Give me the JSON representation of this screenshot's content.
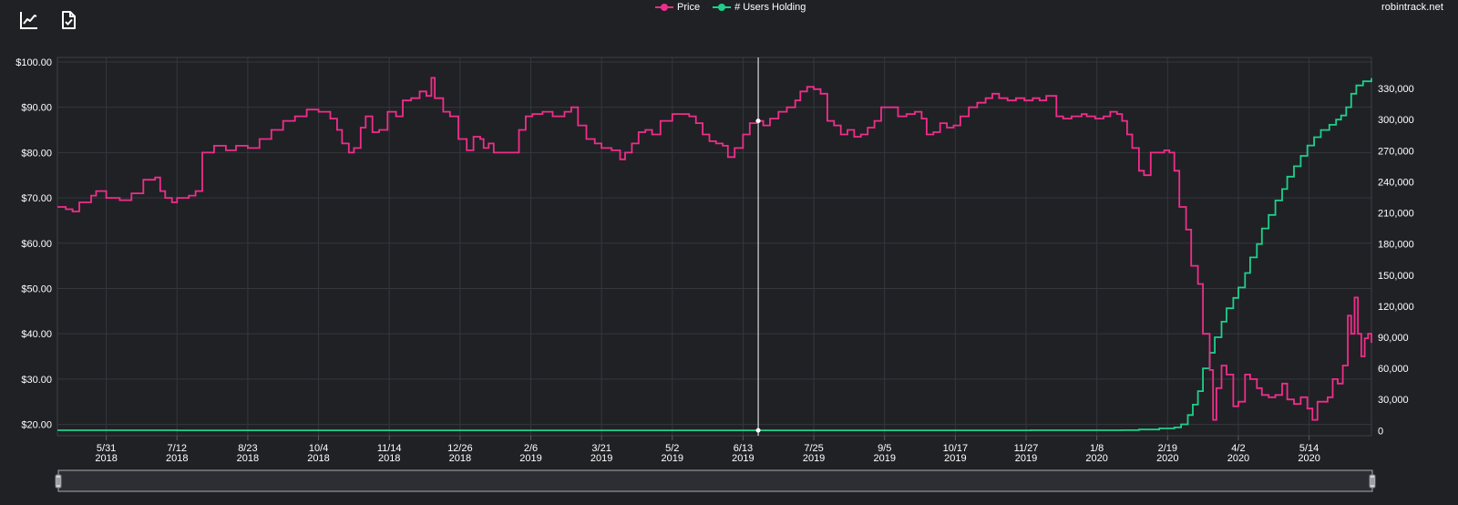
{
  "site": "robintrack.net",
  "toolbar": {
    "icons": [
      "line-chart-icon",
      "file-check-icon"
    ]
  },
  "colors": {
    "price": "#f02d8a",
    "users": "#1ed08a",
    "grid": "#34373c",
    "background": "#1f2125"
  },
  "chart_data": {
    "type": "line",
    "title": "",
    "legend_position": "top-center",
    "grid": true,
    "series": [
      {
        "name": "Price",
        "axis": "left",
        "points": [
          [
            "2018-05-02",
            68.0
          ],
          [
            "2018-05-07",
            67.5
          ],
          [
            "2018-05-11",
            67.0
          ],
          [
            "2018-05-15",
            69.0
          ],
          [
            "2018-05-22",
            70.5
          ],
          [
            "2018-05-25",
            71.5
          ],
          [
            "2018-05-31",
            70.0
          ],
          [
            "2018-06-08",
            69.5
          ],
          [
            "2018-06-15",
            71.0
          ],
          [
            "2018-06-22",
            74.0
          ],
          [
            "2018-06-29",
            74.5
          ],
          [
            "2018-07-02",
            71.5
          ],
          [
            "2018-07-05",
            70.0
          ],
          [
            "2018-07-09",
            69.0
          ],
          [
            "2018-07-12",
            70.0
          ],
          [
            "2018-07-19",
            70.5
          ],
          [
            "2018-07-23",
            71.5
          ],
          [
            "2018-07-26",
            71.5
          ],
          [
            "2018-07-27",
            80.0
          ],
          [
            "2018-08-03",
            81.5
          ],
          [
            "2018-08-10",
            80.5
          ],
          [
            "2018-08-16",
            81.5
          ],
          [
            "2018-08-23",
            81.0
          ],
          [
            "2018-08-30",
            83.0
          ],
          [
            "2018-09-06",
            85.0
          ],
          [
            "2018-09-13",
            87.0
          ],
          [
            "2018-09-20",
            88.0
          ],
          [
            "2018-09-27",
            89.5
          ],
          [
            "2018-10-04",
            89.0
          ],
          [
            "2018-10-11",
            87.5
          ],
          [
            "2018-10-15",
            85.0
          ],
          [
            "2018-10-18",
            82.0
          ],
          [
            "2018-10-22",
            80.0
          ],
          [
            "2018-10-25",
            81.0
          ],
          [
            "2018-10-29",
            85.5
          ],
          [
            "2018-11-01",
            88.0
          ],
          [
            "2018-11-05",
            84.5
          ],
          [
            "2018-11-09",
            85.0
          ],
          [
            "2018-11-14",
            89.0
          ],
          [
            "2018-11-19",
            88.0
          ],
          [
            "2018-11-23",
            91.5
          ],
          [
            "2018-11-28",
            92.0
          ],
          [
            "2018-12-03",
            93.5
          ],
          [
            "2018-12-07",
            92.5
          ],
          [
            "2018-12-10",
            96.5
          ],
          [
            "2018-12-12",
            92.0
          ],
          [
            "2018-12-17",
            89.0
          ],
          [
            "2018-12-21",
            88.0
          ],
          [
            "2018-12-26",
            83.0
          ],
          [
            "2018-12-31",
            80.5
          ],
          [
            "2019-01-04",
            83.5
          ],
          [
            "2019-01-08",
            83.0
          ],
          [
            "2019-01-10",
            81.0
          ],
          [
            "2019-01-13",
            82.0
          ],
          [
            "2019-01-16",
            80.0
          ],
          [
            "2019-01-31",
            85.0
          ],
          [
            "2019-02-04",
            88.0
          ],
          [
            "2019-02-08",
            88.5
          ],
          [
            "2019-02-14",
            89.0
          ],
          [
            "2019-02-20",
            88.0
          ],
          [
            "2019-02-27",
            89.0
          ],
          [
            "2019-03-03",
            90.0
          ],
          [
            "2019-03-07",
            86.0
          ],
          [
            "2019-03-12",
            83.0
          ],
          [
            "2019-03-17",
            82.0
          ],
          [
            "2019-03-21",
            81.0
          ],
          [
            "2019-03-27",
            80.5
          ],
          [
            "2019-04-01",
            78.5
          ],
          [
            "2019-04-04",
            80.0
          ],
          [
            "2019-04-08",
            82.0
          ],
          [
            "2019-04-12",
            84.5
          ],
          [
            "2019-04-16",
            85.0
          ],
          [
            "2019-04-20",
            84.0
          ],
          [
            "2019-04-25",
            87.0
          ],
          [
            "2019-05-02",
            88.5
          ],
          [
            "2019-05-07",
            88.5
          ],
          [
            "2019-05-12",
            88.0
          ],
          [
            "2019-05-16",
            86.5
          ],
          [
            "2019-05-20",
            84.0
          ],
          [
            "2019-05-24",
            82.5
          ],
          [
            "2019-05-28",
            82.0
          ],
          [
            "2019-06-01",
            81.5
          ],
          [
            "2019-06-04",
            79.0
          ],
          [
            "2019-06-08",
            81.0
          ],
          [
            "2019-06-13",
            84.0
          ],
          [
            "2019-06-17",
            86.5
          ],
          [
            "2019-06-21",
            87.0
          ],
          [
            "2019-06-25",
            86.0
          ],
          [
            "2019-06-29",
            87.5
          ],
          [
            "2019-07-04",
            89.0
          ],
          [
            "2019-07-09",
            90.0
          ],
          [
            "2019-07-14",
            91.5
          ],
          [
            "2019-07-17",
            93.5
          ],
          [
            "2019-07-21",
            94.5
          ],
          [
            "2019-07-25",
            94.0
          ],
          [
            "2019-07-29",
            93.0
          ],
          [
            "2019-08-02",
            87.0
          ],
          [
            "2019-08-06",
            86.0
          ],
          [
            "2019-08-10",
            84.0
          ],
          [
            "2019-08-14",
            85.0
          ],
          [
            "2019-08-18",
            83.5
          ],
          [
            "2019-08-22",
            84.0
          ],
          [
            "2019-08-26",
            85.5
          ],
          [
            "2019-08-30",
            87.0
          ],
          [
            "2019-09-03",
            90.0
          ],
          [
            "2019-09-08",
            90.0
          ],
          [
            "2019-09-13",
            88.0
          ],
          [
            "2019-09-18",
            88.5
          ],
          [
            "2019-09-23",
            89.0
          ],
          [
            "2019-09-27",
            87.5
          ],
          [
            "2019-09-30",
            84.0
          ],
          [
            "2019-10-04",
            84.5
          ],
          [
            "2019-10-08",
            86.5
          ],
          [
            "2019-10-12",
            85.5
          ],
          [
            "2019-10-16",
            86.0
          ],
          [
            "2019-10-20",
            88.0
          ],
          [
            "2019-10-25",
            90.0
          ],
          [
            "2019-10-30",
            91.0
          ],
          [
            "2019-11-04",
            92.0
          ],
          [
            "2019-11-08",
            93.0
          ],
          [
            "2019-11-12",
            92.0
          ],
          [
            "2019-11-17",
            91.5
          ],
          [
            "2019-11-22",
            92.0
          ],
          [
            "2019-11-27",
            91.5
          ],
          [
            "2019-12-02",
            92.0
          ],
          [
            "2019-12-06",
            91.5
          ],
          [
            "2019-12-10",
            92.5
          ],
          [
            "2019-12-14",
            92.5
          ],
          [
            "2019-12-16",
            88.0
          ],
          [
            "2019-12-20",
            87.5
          ],
          [
            "2019-12-25",
            88.0
          ],
          [
            "2019-12-31",
            88.5
          ],
          [
            "2020-01-03",
            88.0
          ],
          [
            "2020-01-08",
            87.5
          ],
          [
            "2020-01-13",
            88.0
          ],
          [
            "2020-01-17",
            89.0
          ],
          [
            "2020-01-21",
            88.5
          ],
          [
            "2020-01-24",
            87.0
          ],
          [
            "2020-01-27",
            84.0
          ],
          [
            "2020-01-30",
            81.0
          ],
          [
            "2020-02-03",
            76.0
          ],
          [
            "2020-02-06",
            75.0
          ],
          [
            "2020-02-10",
            80.0
          ],
          [
            "2020-02-14",
            80.0
          ],
          [
            "2020-02-18",
            80.5
          ],
          [
            "2020-02-21",
            80.0
          ],
          [
            "2020-02-24",
            76.0
          ],
          [
            "2020-02-27",
            68.0
          ],
          [
            "2020-03-02",
            63.0
          ],
          [
            "2020-03-05",
            55.0
          ],
          [
            "2020-03-09",
            51.0
          ],
          [
            "2020-03-12",
            40.0
          ],
          [
            "2020-03-16",
            32.0
          ],
          [
            "2020-03-18",
            21.0
          ],
          [
            "2020-03-20",
            28.0
          ],
          [
            "2020-03-23",
            33.0
          ],
          [
            "2020-03-26",
            31.0
          ],
          [
            "2020-03-30",
            24.0
          ],
          [
            "2020-04-02",
            25.0
          ],
          [
            "2020-04-06",
            31.0
          ],
          [
            "2020-04-09",
            30.0
          ],
          [
            "2020-04-13",
            28.0
          ],
          [
            "2020-04-16",
            26.5
          ],
          [
            "2020-04-20",
            26.0
          ],
          [
            "2020-04-24",
            26.5
          ],
          [
            "2020-04-28",
            29.0
          ],
          [
            "2020-05-01",
            25.5
          ],
          [
            "2020-05-05",
            24.5
          ],
          [
            "2020-05-09",
            26.0
          ],
          [
            "2020-05-13",
            23.5
          ],
          [
            "2020-05-16",
            21.0
          ],
          [
            "2020-05-19",
            25.0
          ],
          [
            "2020-05-22",
            25.0
          ],
          [
            "2020-05-25",
            26.0
          ],
          [
            "2020-05-28",
            30.0
          ],
          [
            "2020-05-31",
            29.0
          ],
          [
            "2020-06-03",
            33.0
          ],
          [
            "2020-06-06",
            44.0
          ],
          [
            "2020-06-08",
            40.0
          ],
          [
            "2020-06-10",
            48.0
          ],
          [
            "2020-06-12",
            40.0
          ],
          [
            "2020-06-14",
            35.0
          ],
          [
            "2020-06-16",
            39.0
          ],
          [
            "2020-06-18",
            40.0
          ],
          [
            "2020-06-20",
            38.0
          ]
        ]
      },
      {
        "name": "# Users Holding",
        "axis": "right",
        "points": [
          [
            "2018-05-02",
            300
          ],
          [
            "2018-07-12",
            200
          ],
          [
            "2019-01-01",
            200
          ],
          [
            "2019-06-17",
            200
          ],
          [
            "2019-12-01",
            300
          ],
          [
            "2020-01-24",
            400
          ],
          [
            "2020-02-03",
            1000
          ],
          [
            "2020-02-15",
            2000
          ],
          [
            "2020-02-24",
            3000
          ],
          [
            "2020-02-28",
            6000
          ],
          [
            "2020-03-03",
            15000
          ],
          [
            "2020-03-06",
            25000
          ],
          [
            "2020-03-09",
            38000
          ],
          [
            "2020-03-12",
            60000
          ],
          [
            "2020-03-16",
            75000
          ],
          [
            "2020-03-19",
            90000
          ],
          [
            "2020-03-23",
            105000
          ],
          [
            "2020-03-26",
            118000
          ],
          [
            "2020-03-30",
            128000
          ],
          [
            "2020-04-02",
            138000
          ],
          [
            "2020-04-06",
            152000
          ],
          [
            "2020-04-09",
            167000
          ],
          [
            "2020-04-13",
            180000
          ],
          [
            "2020-04-16",
            195000
          ],
          [
            "2020-04-20",
            208000
          ],
          [
            "2020-04-24",
            222000
          ],
          [
            "2020-04-28",
            233000
          ],
          [
            "2020-05-01",
            245000
          ],
          [
            "2020-05-05",
            255000
          ],
          [
            "2020-05-09",
            265000
          ],
          [
            "2020-05-13",
            275000
          ],
          [
            "2020-05-17",
            283000
          ],
          [
            "2020-05-21",
            290000
          ],
          [
            "2020-05-26",
            295000
          ],
          [
            "2020-05-30",
            300000
          ],
          [
            "2020-06-02",
            304000
          ],
          [
            "2020-06-05",
            312000
          ],
          [
            "2020-06-08",
            325000
          ],
          [
            "2020-06-11",
            333000
          ],
          [
            "2020-06-15",
            337000
          ],
          [
            "2020-06-20",
            340000
          ]
        ]
      }
    ],
    "x_range": [
      "2018-05-02",
      "2020-06-20"
    ],
    "x_ticks": [
      {
        "date": "2018-05-31",
        "label": "5/31",
        "year": "2018"
      },
      {
        "date": "2018-07-12",
        "label": "7/12",
        "year": "2018"
      },
      {
        "date": "2018-08-23",
        "label": "8/23",
        "year": "2018"
      },
      {
        "date": "2018-10-04",
        "label": "10/4",
        "year": "2018"
      },
      {
        "date": "2018-11-15",
        "label": "11/14",
        "year": "2018"
      },
      {
        "date": "2018-12-27",
        "label": "12/26",
        "year": "2018"
      },
      {
        "date": "2019-02-07",
        "label": "2/6",
        "year": "2019"
      },
      {
        "date": "2019-03-21",
        "label": "3/21",
        "year": "2019"
      },
      {
        "date": "2019-05-02",
        "label": "5/2",
        "year": "2019"
      },
      {
        "date": "2019-06-13",
        "label": "6/13",
        "year": "2019"
      },
      {
        "date": "2019-07-25",
        "label": "7/25",
        "year": "2019"
      },
      {
        "date": "2019-09-05",
        "label": "9/5",
        "year": "2019"
      },
      {
        "date": "2019-10-17",
        "label": "10/17",
        "year": "2019"
      },
      {
        "date": "2019-11-28",
        "label": "11/27",
        "year": "2019"
      },
      {
        "date": "2020-01-09",
        "label": "1/8",
        "year": "2020"
      },
      {
        "date": "2020-02-20",
        "label": "2/19",
        "year": "2020"
      },
      {
        "date": "2020-04-02",
        "label": "4/2",
        "year": "2020"
      },
      {
        "date": "2020-05-14",
        "label": "5/14",
        "year": "2020"
      }
    ],
    "y_left": {
      "range": [
        17.5,
        101.0
      ],
      "ticks": [
        20,
        30,
        40,
        50,
        60,
        70,
        80,
        90,
        100
      ],
      "tick_labels": [
        "$20.00",
        "$30.00",
        "$40.00",
        "$50.00",
        "$60.00",
        "$70.00",
        "$80.00",
        "$90.00",
        "$100.00"
      ]
    },
    "y_right": {
      "range": [
        -5000,
        360000
      ],
      "ticks": [
        0,
        30000,
        60000,
        90000,
        120000,
        150000,
        180000,
        210000,
        240000,
        270000,
        300000,
        330000
      ],
      "tick_labels": [
        "0",
        "30,000",
        "60,000",
        "90,000",
        "120,000",
        "150,000",
        "180,000",
        "210,000",
        "240,000",
        "270,000",
        "300,000",
        "330,000"
      ]
    },
    "crosshair_date": "2019-06-22"
  },
  "range_selector": {
    "start": "2018-05-02",
    "end": "2020-06-20"
  }
}
